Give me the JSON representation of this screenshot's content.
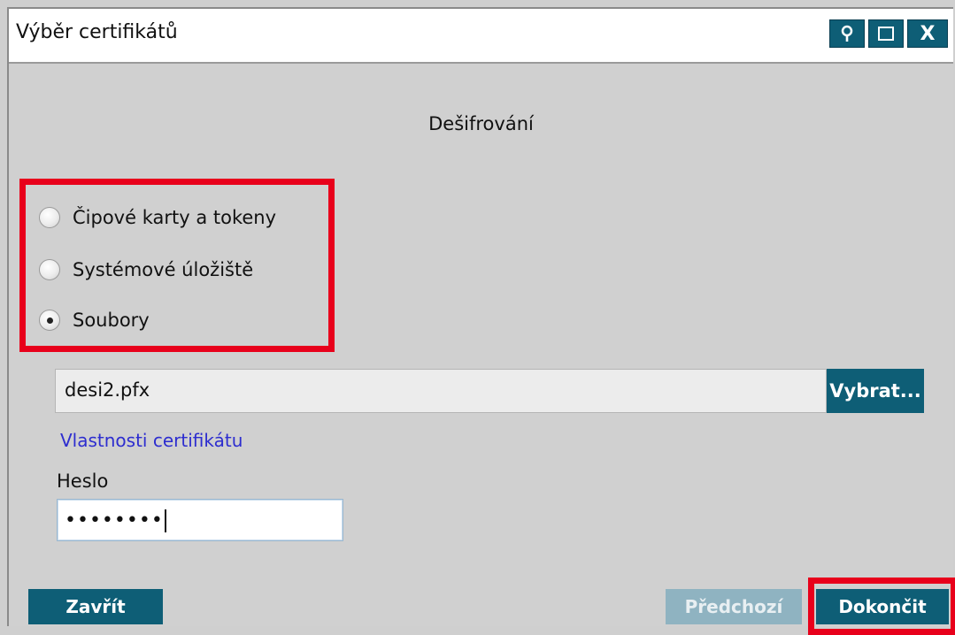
{
  "window": {
    "title": "Výběr certifikátů",
    "controls": {
      "restore_icon": "pin-icon",
      "maximize_icon": "maximize-icon",
      "close_label": "X"
    }
  },
  "heading": "Dešifrování",
  "source_options": [
    {
      "label": "Čipové karty a tokeny",
      "checked": false
    },
    {
      "label": "Systémové úložiště",
      "checked": false
    },
    {
      "label": "Soubory",
      "checked": true
    }
  ],
  "file": {
    "value": "desi2.pfx",
    "browse_label": "Vybrat..."
  },
  "cert_properties_link": "Vlastnosti certifikátu",
  "password": {
    "label": "Heslo",
    "masked_value": "••••••••"
  },
  "footer": {
    "close_label": "Zavřít",
    "previous_label": "Předchozí",
    "finish_label": "Dokončit"
  },
  "colors": {
    "accent": "#0e5e76",
    "highlight": "#e8001b",
    "disabled": "#8fb3c1",
    "link": "#2d2dcf"
  }
}
